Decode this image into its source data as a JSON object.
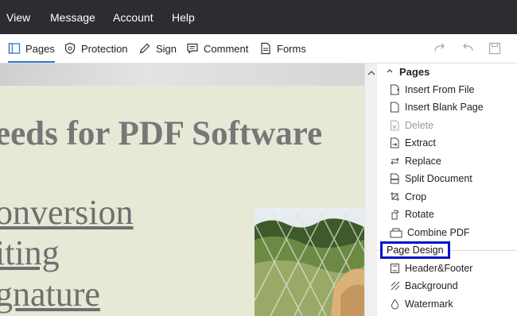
{
  "menu": {
    "items": [
      "View",
      "Message",
      "Account",
      "Help"
    ]
  },
  "tabs": [
    {
      "label": "Pages",
      "icon": "pages-icon",
      "active": true
    },
    {
      "label": "Protection",
      "icon": "shield-icon",
      "active": false
    },
    {
      "label": "Sign",
      "icon": "pen-icon",
      "active": false
    },
    {
      "label": "Comment",
      "icon": "comment-icon",
      "active": false
    },
    {
      "label": "Forms",
      "icon": "form-icon",
      "active": false
    }
  ],
  "toolbar_icons": [
    "redo-icon",
    "undo-icon",
    "save-icon"
  ],
  "document": {
    "title_text": "eeds for PDF Software",
    "items": [
      "onversion",
      "iting",
      "gnature"
    ]
  },
  "panel": {
    "pages_header": "Pages",
    "pages_items": [
      {
        "label": "Insert From File",
        "icon": "insert-file-icon",
        "enabled": true
      },
      {
        "label": "Insert Blank Page",
        "icon": "blank-page-icon",
        "enabled": true
      },
      {
        "label": "Delete",
        "icon": "delete-page-icon",
        "enabled": false
      },
      {
        "label": "Extract",
        "icon": "extract-icon",
        "enabled": true
      },
      {
        "label": "Replace",
        "icon": "replace-icon",
        "enabled": true
      },
      {
        "label": "Split Document",
        "icon": "split-icon",
        "enabled": true
      },
      {
        "label": "Crop",
        "icon": "crop-icon",
        "enabled": true
      },
      {
        "label": "Rotate",
        "icon": "rotate-icon",
        "enabled": true
      },
      {
        "label": "Combine PDF",
        "icon": "combine-icon",
        "enabled": true
      }
    ],
    "design_section": "Page Design",
    "design_items": [
      {
        "label": "Header&Footer",
        "icon": "header-footer-icon",
        "enabled": true
      },
      {
        "label": "Background",
        "icon": "background-icon",
        "enabled": true
      },
      {
        "label": "Watermark",
        "icon": "watermark-icon",
        "enabled": true
      }
    ]
  },
  "colors": {
    "menubar": "#2b2d33",
    "accent": "#2f7ad0",
    "highlight_box": "#0014c8",
    "page_bg": "#e7e8d6"
  }
}
